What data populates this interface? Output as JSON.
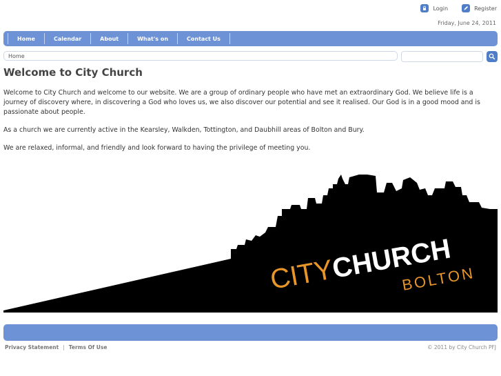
{
  "header": {
    "login_label": "Login",
    "register_label": "Register",
    "date": "Friday, June 24, 2011"
  },
  "nav": {
    "items": [
      {
        "label": "Home"
      },
      {
        "label": "Calendar"
      },
      {
        "label": "About"
      },
      {
        "label": "What's on"
      },
      {
        "label": "Contact Us"
      }
    ]
  },
  "breadcrumb": {
    "current": "Home"
  },
  "search": {
    "placeholder": ""
  },
  "main": {
    "title": "Welcome to City Church",
    "paragraphs": [
      "Welcome to City Church and welcome to our website. We are a group of ordinary people who have met an extraordinary God.  We believe life is a journey of discovery where, in discovering a God who loves us, we also discover our potential and see it realised. Our God is in a good mood and is passionate about people.",
      "As a church we are currently active in the Kearsley, Walkden, Tottington, and Daubhill areas of Bolton and Bury.",
      "We are relaxed, informal, and friendly and look forward to having the privilege of meeting you."
    ]
  },
  "banner": {
    "logo_city": "CITY",
    "logo_church": "CHURCH",
    "logo_bolton": "BOLTON",
    "colors": {
      "orange": "#e8962a",
      "white": "#ffffff",
      "black": "#000000"
    }
  },
  "footer": {
    "privacy_label": "Privacy Statement",
    "separator": "|",
    "terms_label": "Terms Of Use",
    "copyright": "© 2011 by City Church PFJ"
  },
  "icons": [
    "login-icon",
    "register-icon",
    "search-icon"
  ]
}
